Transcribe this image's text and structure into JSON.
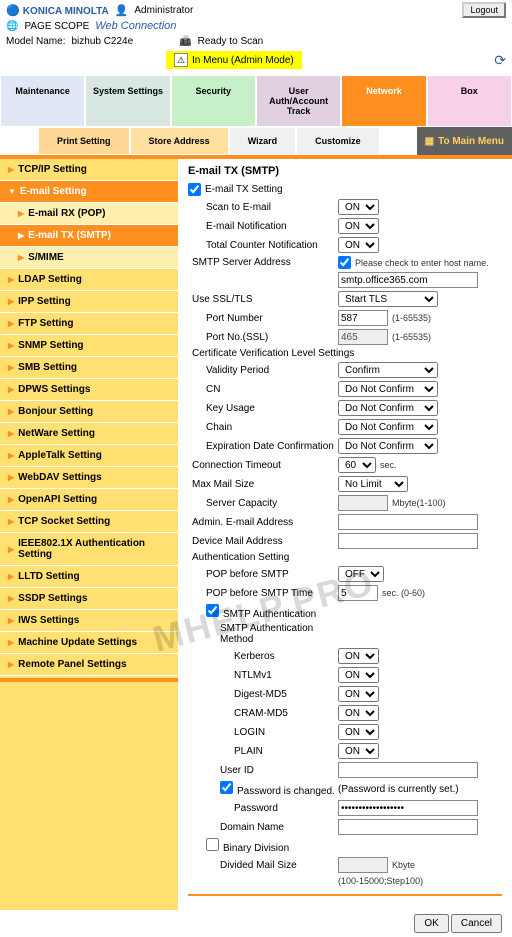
{
  "header": {
    "brand": "KONICA MINOLTA",
    "pagescope": "PAGE SCOPE",
    "webconn": "Web Connection",
    "admin": "Administrator",
    "logout": "Logout"
  },
  "model": {
    "label": "Model Name:",
    "value": "bizhub C224e"
  },
  "status": {
    "ready": "Ready to Scan",
    "menu": "In Menu (Admin Mode)"
  },
  "tabs": {
    "maint": "Maintenance",
    "sys": "System Settings",
    "sec": "Security",
    "user": "User Auth/Account Track",
    "net": "Network",
    "box": "Box"
  },
  "tabs2": {
    "print": "Print Setting",
    "store": "Store Address",
    "wiz": "Wizard",
    "cust": "Customize",
    "tomain": "To Main Menu"
  },
  "side": {
    "tcpip": "TCP/IP Setting",
    "email": "E-mail Setting",
    "emailrx": "E-mail RX (POP)",
    "emailtx": "E-mail TX (SMTP)",
    "smime": "S/MIME",
    "ldap": "LDAP Setting",
    "ipp": "IPP Setting",
    "ftp": "FTP Setting",
    "snmp": "SNMP Setting",
    "smb": "SMB Setting",
    "dpws": "DPWS Settings",
    "bonjour": "Bonjour Setting",
    "netware": "NetWare Setting",
    "apple": "AppleTalk Setting",
    "webdav": "WebDAV Settings",
    "openapi": "OpenAPI Setting",
    "tcpsock": "TCP Socket Setting",
    "ieee": "IEEE802.1X Authentication Setting",
    "lltd": "LLTD Setting",
    "ssdp": "SSDP Settings",
    "iws": "IWS Settings",
    "machine": "Machine Update Settings",
    "remote": "Remote Panel Settings"
  },
  "page": {
    "title": "E-mail TX (SMTP)",
    "txsetting": "E-mail TX Setting",
    "scan": "Scan to E-mail",
    "scanv": "ON",
    "notif": "E-mail Notification",
    "notifv": "ON",
    "tcn": "Total Counter Notification",
    "tcnv": "ON",
    "smtpaddr": "SMTP Server Address",
    "hostchk": "Please check to enter host name.",
    "smtpval": "smtp.office365.com",
    "ssl": "Use SSL/TLS",
    "sslv": "Start TLS",
    "port": "Port Number",
    "portv": "587",
    "portrange": "(1-65535)",
    "portssl": "Port No.(SSL)",
    "portsslv": "465",
    "cert": "Certificate Verification Level Settings",
    "valid": "Validity Period",
    "validv": "Confirm",
    "cn": "CN",
    "cnv": "Do Not Confirm",
    "keyusage": "Key Usage",
    "keyv": "Do Not Confirm",
    "chain": "Chain",
    "chainv": "Do Not Confirm",
    "exp": "Expiration Date Confirmation",
    "expv": "Do Not Confirm",
    "conntime": "Connection Timeout",
    "conntimev": "60",
    "sec": "sec.",
    "maxmail": "Max Mail Size",
    "maxmailv": "No Limit",
    "servcap": "Server Capacity",
    "servcapunit": "Mbyte(1-100)",
    "adminaddr": "Admin. E-mail Address",
    "devaddr": "Device Mail Address",
    "authset": "Authentication Setting",
    "popb4": "POP before SMTP",
    "popb4v": "OFF",
    "popb4t": "POP before SMTP Time",
    "popb4tv": "5",
    "popb4tunit": "sec. (0-60)",
    "smtpauth": "SMTP Authentication",
    "authmethod": "SMTP Authentication Method",
    "kerb": "Kerberos",
    "kerbv": "ON",
    "ntlm": "NTLMv1",
    "ntlmv": "ON",
    "digest": "Digest-MD5",
    "digestv": "ON",
    "cram": "CRAM-MD5",
    "cramv": "ON",
    "login": "LOGIN",
    "loginv": "ON",
    "plain": "PLAIN",
    "plainv": "ON",
    "userid": "User ID",
    "pwdchg": "Password is changed.",
    "pwdset": "(Password is currently set.)",
    "pwd": "Password",
    "pwdv": "••••••••••••••••••",
    "domain": "Domain Name",
    "binary": "Binary Division",
    "divsize": "Divided Mail Size",
    "divunit": "Kbyte",
    "divrange": "(100-15000;Step100)",
    "ok": "OK",
    "cancel": "Cancel"
  },
  "watermark": "MHELP.PRO"
}
